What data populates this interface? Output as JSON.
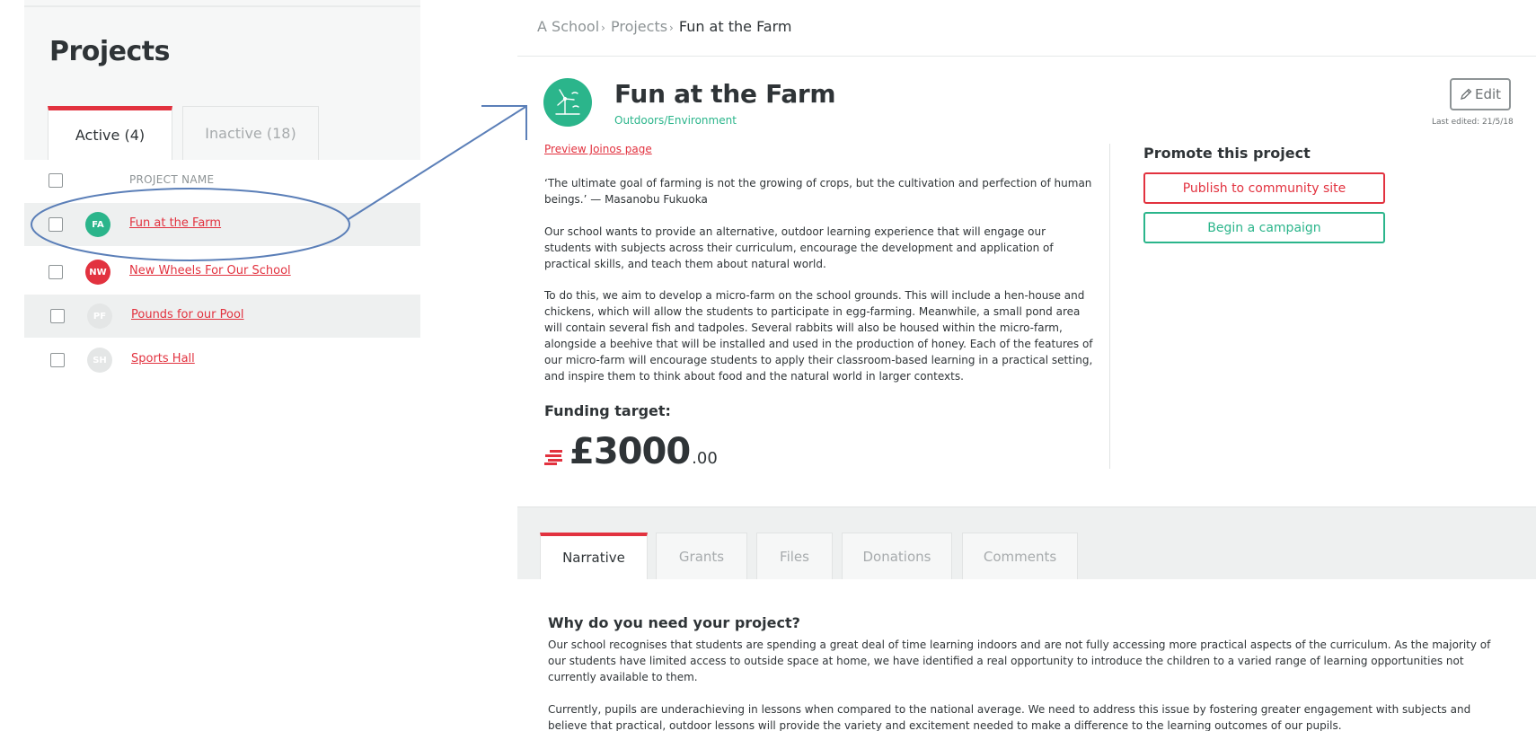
{
  "sidebar": {
    "title": "Projects",
    "tabs": [
      {
        "label": "Active (4)",
        "active": true
      },
      {
        "label": "Inactive (18)",
        "active": false
      }
    ],
    "column_header": "PROJECT NAME",
    "rows": [
      {
        "initials": "FA",
        "name": "Fun at the Farm",
        "avatar_color": "#2bb58b"
      },
      {
        "initials": "NW",
        "name": "New Wheels For Our School",
        "avatar_color": "#e2323f"
      },
      {
        "initials": "PF",
        "name": "Pounds for our Pool",
        "avatar_color": "#e4e6e6"
      },
      {
        "initials": "SH",
        "name": "Sports Hall",
        "avatar_color": "#e4e6e6"
      }
    ]
  },
  "breadcrumb": {
    "items": [
      "A School",
      "Projects"
    ],
    "separator": "›",
    "current": "Fun at the Farm"
  },
  "project": {
    "icon": "wind-turbine-icon",
    "title": "Fun at the Farm",
    "category": "Outdoors/Environment",
    "edit_label": "Edit",
    "last_edited": "Last edited: 21/5/18",
    "preview_link": "Preview Joinos page",
    "quote": "‘The ultimate goal of farming is not the growing of crops, but the cultivation and perfection of human beings.’ — Masanobu Fukuoka",
    "paragraph_1": "Our school wants to provide an alternative, outdoor learning experience that will engage our students with subjects across their curriculum, encourage the development and application of practical skills, and teach them about natural world.",
    "paragraph_2": "To do this, we aim to develop a micro-farm on the school grounds. This will include a hen-house and chickens, which will allow the students to participate in egg-farming. Meanwhile, a small pond area will contain several fish and tadpoles. Several rabbits will also be housed within the micro-farm, alongside a beehive that will be installed and used in the production of honey. Each of the features of our micro-farm will encourage students to apply their classroom-based learning in a practical setting, and inspire them to think about food and the natural world in larger contexts.",
    "funding_label": "Funding target:",
    "funding_amount": "£3000",
    "funding_cents": ".00"
  },
  "promote": {
    "title": "Promote this project",
    "publish_label": "Publish to community site",
    "campaign_label": "Begin a campaign"
  },
  "detail_tabs": [
    {
      "label": "Narrative",
      "active": true
    },
    {
      "label": "Grants",
      "active": false
    },
    {
      "label": "Files",
      "active": false
    },
    {
      "label": "Donations",
      "active": false
    },
    {
      "label": "Comments",
      "active": false
    }
  ],
  "narrative": {
    "heading": "Why do you need your project?",
    "paragraph_1": "Our school recognises that students are spending a great deal of time learning indoors and are not fully accessing more practical aspects of the curriculum. As the majority of our students have limited access to outside space at home, we have identified a real opportunity to introduce the children to a varied range of learning opportunities not currently available to them.",
    "paragraph_2": "Currently, pupils are underachieving in lessons when compared to the national average. We need to address this issue by fostering greater engagement with subjects and believe that practical, outdoor lessons will provide the variety and excitement needed to make a difference to the learning outcomes of our pupils."
  },
  "colors": {
    "accent_red": "#e2323f",
    "accent_green": "#2bb58b",
    "annotation_blue": "#5b7fb8"
  }
}
